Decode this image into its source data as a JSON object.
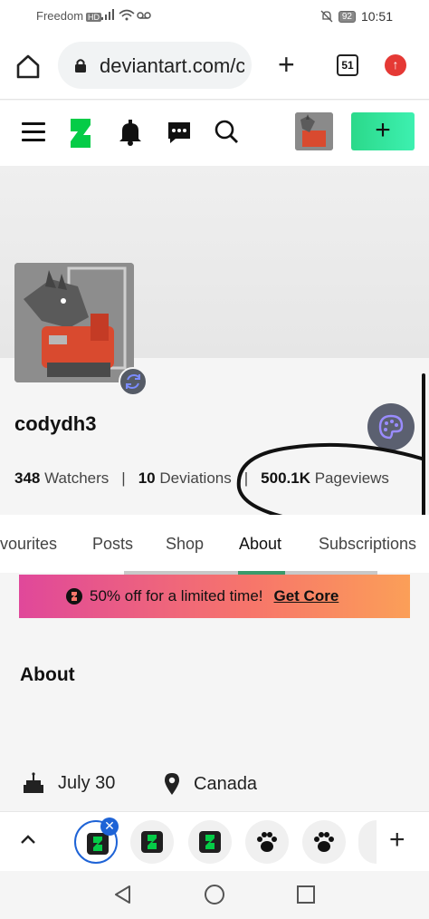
{
  "status_bar": {
    "carrier": "Freedom",
    "hd_badge": "HD",
    "battery": "92",
    "time": "10:51"
  },
  "browser": {
    "url": "deviantart.com/c",
    "tab_count": "51",
    "icons": [
      "home-icon",
      "lock-icon",
      "new-tab-icon",
      "tabs-icon",
      "update-icon"
    ]
  },
  "header": {
    "icons": [
      "menu-icon",
      "deviantart-logo",
      "bell-icon",
      "chat-icon",
      "search-icon"
    ],
    "create_label": "+",
    "accent": "#2bd98a"
  },
  "profile": {
    "username": "codydh3",
    "watchers_count": "348",
    "watchers_label": "Watchers",
    "deviations_count": "10",
    "deviations_label": "Deviations",
    "pageviews_count": "500.1K",
    "pageviews_label": "Pageviews",
    "separator": "|"
  },
  "tabs": [
    "vourites",
    "Posts",
    "Shop",
    "About",
    "Subscriptions"
  ],
  "active_tab": "About",
  "promo": {
    "text": "50% off for a limited time!",
    "link": "Get Core"
  },
  "about": {
    "title": "About",
    "birthday": "July 30",
    "location": "Canada"
  },
  "tab_strip": {
    "new_tab_label": "+",
    "close_label": "✕"
  }
}
